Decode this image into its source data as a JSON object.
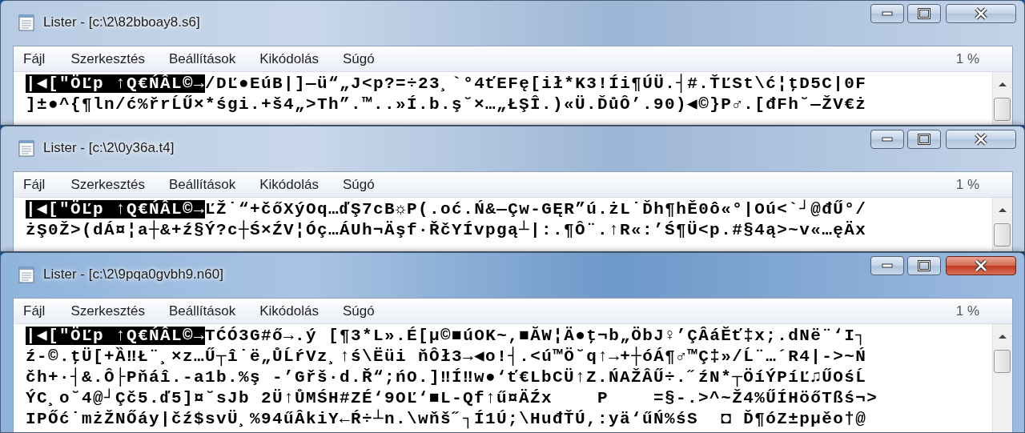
{
  "windows": [
    {
      "title": "Lister - [c:\\2\\82bboay8.s6]",
      "active": false,
      "menu": [
        "Fájl",
        "Szerkesztés",
        "Beállítások",
        "Kikódolás",
        "Súgó"
      ],
      "percent": "1 %",
      "lines": [
        {
          "segments": [
            {
              "text": "|◀[\"ÖĽp ↑Q€ŃÂL©→",
              "highlighted": true
            },
            {
              "text": "/DĽ●EúB|]—ü“„J<p?=÷23¸`°4ťEFę[ił*K3!Íi¶ÚÜ.┤#.ŤĽSt\\ć¦ţD5C|0F",
              "highlighted": false
            }
          ]
        },
        {
          "segments": [
            {
              "text": "]±●^{¶ln/ć%řrĹŰ×*śgi.+š4„>Th”.™..»Í.b.ş˘×…„ŁŞÎ.)«Ü.ĎůÔ’.90)◀©}P♂.[đFh˘—ŽV€ż",
              "highlighted": false
            }
          ]
        }
      ]
    },
    {
      "title": "Lister - [c:\\2\\0y36a.t4]",
      "active": false,
      "menu": [
        "Fájl",
        "Szerkesztés",
        "Beállítások",
        "Kikódolás",
        "Súgó"
      ],
      "percent": "1 %",
      "lines": [
        {
          "segments": [
            {
              "text": "|◀[\"ÖĽp ↑Q€ŃÂL©→",
              "highlighted": true
            },
            {
              "text": "ĽŽ˙“+čőXýOq…ďŞ7cB☼P(.oć.Ń&—Çw-GĘR”ú.żL˙Ďh¶hĚ0ô«°|Oú<`┘@đŰ°/",
              "highlighted": false
            }
          ]
        },
        {
          "segments": [
            {
              "text": "żŞ0Ž>(dÁ¤¦a┼&+ź§Ý?c┼Ś×ŹV¦Óç…ÁUh¬Äşf·ŘčYÍvpgą┴|:.¶Ô¨.↑R«:’Ś¶Ü<p.#§4ą>~v«…ęÄx",
              "highlighted": false
            }
          ]
        }
      ]
    },
    {
      "title": "Lister - [c:\\2\\9pqa0gvbh9.n60]",
      "active": true,
      "menu": [
        "Fájl",
        "Szerkesztés",
        "Beállítások",
        "Kikódolás",
        "Súgó"
      ],
      "percent": "1 %",
      "lines": [
        {
          "segments": [
            {
              "text": "|◀[\"ÖĽp ↑Q€ŃÂL©→",
              "highlighted": true
            },
            {
              "text": "TĆÓ3G#ő→.ý [¶3*L».É[µ©■úOK~,■ĂW¦Ä●ţ¬b„ÖbJ♀’ÇÂáĔť‡x;.dNë¨‘I┐",
              "highlighted": false
            }
          ]
        },
        {
          "segments": [
            {
              "text": "ź-©.ţÜ[+Ȁ‼Ł¨¸×z…Ű┬î˙ë„ŮĹŕVz¸↑ś\\Ëüi ňÔł3→◀o!┤.<ú™Ö˘q↑→+┼óÁ¶♂™Ç‡»/Ĺ¨…´R4|->~Ń",
              "highlighted": false
            }
          ]
        },
        {
          "segments": [
            {
              "text": "čh+·┤&.Ô├Pňáî.-a1b.%ş -’Gřš·d.Ř“;ńO.]‼Í‼w●‘ť€LbCÜ↑Z.ŃAŽÂŰ÷.˝źN*┬ÖíÝPíĽ♫ŰOśĹ",
              "highlighted": false
            }
          ]
        },
        {
          "segments": [
            {
              "text": "ÝC¸o˘4@┘Çč5.ď5]¤˘sJb 2Ü↑ŮMŚH#ZÉ‘9OĽ‘■L-Qf↑ű¤ÄŹx    P    =§-.>^~Ž4%ŰÍHöőTßś¬>",
              "highlighted": false
            }
          ]
        },
        {
          "segments": [
            {
              "text": "IPŐć˙mżŽNŐáy|čź$svÜ¸%94űÂkiY←Ŕ÷┴n.\\wňš˝┐Í1Ú;\\HuđŤÚ,:yä‘űŃ%śS  ◘ Ď¶óZ±pµěo†@",
              "highlighted": false
            }
          ]
        }
      ]
    }
  ]
}
